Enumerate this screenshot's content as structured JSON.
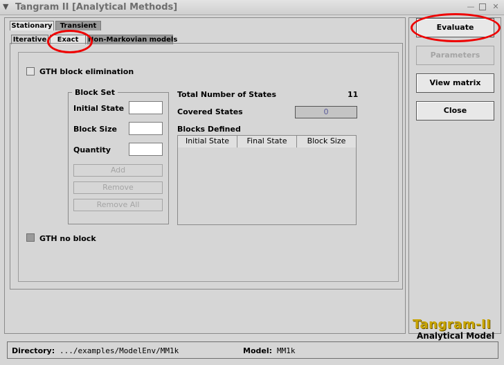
{
  "window": {
    "title": "Tangram II [Analytical Methods]",
    "controls": [
      "minimize-icon",
      "maximize-icon",
      "close-icon"
    ]
  },
  "tabs": {
    "primary": [
      {
        "label": "Stationary",
        "active": true
      },
      {
        "label": "Transient",
        "active": false
      }
    ],
    "secondary": [
      {
        "label": "Iterative",
        "active": false
      },
      {
        "label": "Exact",
        "active": true
      },
      {
        "label": "Non-Markovian models",
        "active": false
      }
    ]
  },
  "exact": {
    "gth_block_label": "GTH block elimination",
    "gth_block_checked": false,
    "block_set": {
      "legend": "Block Set",
      "initial_state_label": "Initial State",
      "initial_state_value": "",
      "block_size_label": "Block Size",
      "block_size_value": "",
      "quantity_label": "Quantity",
      "quantity_value": "",
      "add_label": "Add",
      "remove_label": "Remove",
      "remove_all_label": "Remove All"
    },
    "total_states_label": "Total Number of States",
    "total_states_value": "11",
    "covered_states_label": "Covered States",
    "covered_states_value": "0",
    "blocks_defined_label": "Blocks Defined",
    "table_headers": [
      "Initial State",
      "Final State",
      "Block Size"
    ],
    "table_rows": [],
    "gth_no_block_label": "GTH no block",
    "gth_no_block_checked": true
  },
  "actions": {
    "evaluate": "Evaluate",
    "parameters": "Parameters",
    "view_matrix": "View matrix",
    "close": "Close"
  },
  "logo": {
    "line1": "Tangram-II",
    "line2": "Analytical Model",
    "color": "#c8a400"
  },
  "status": {
    "directory_label": "Directory:",
    "directory_value": ".../examples/ModelEnv/MM1k",
    "model_label": "Model:",
    "model_value": "MM1k"
  },
  "highlight_color": "#ee0000"
}
